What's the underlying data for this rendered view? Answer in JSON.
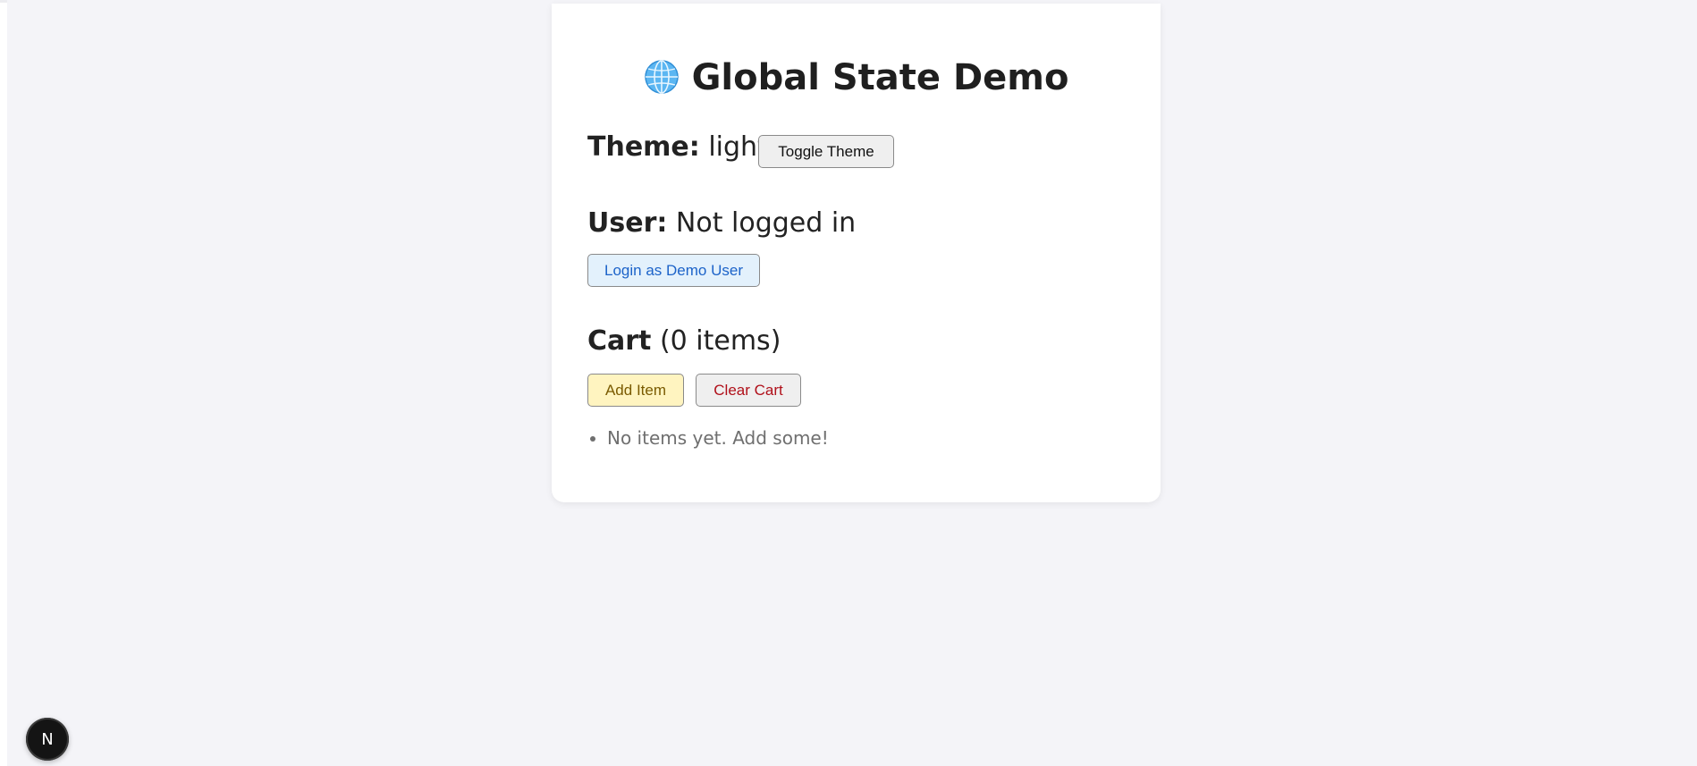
{
  "card": {
    "title": "Global State Demo",
    "title_icon": "globe-icon"
  },
  "theme": {
    "label": "Theme:",
    "value": "light",
    "toggle_button": "Toggle Theme"
  },
  "user": {
    "label": "User:",
    "value": "Not logged in",
    "login_button": "Login as Demo User"
  },
  "cart": {
    "label": "Cart",
    "count_text": "(0 items)",
    "add_button": "Add Item",
    "clear_button": "Clear Cart",
    "items": [
      "No items yet. Add some!"
    ]
  },
  "dev_badge": {
    "icon": "nextjs-logo-icon",
    "letter": "N"
  },
  "colors": {
    "page_bg": "#f4f4f8",
    "card_bg": "#ffffff",
    "login_bg": "#e3f1fc",
    "login_text": "#1c63c9",
    "add_bg": "#fff4c0",
    "clear_text": "#b0101a"
  }
}
